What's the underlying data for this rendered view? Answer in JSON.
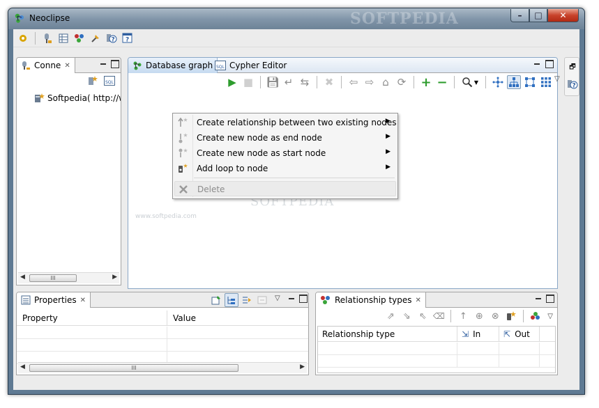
{
  "window": {
    "title": "Neoclipse",
    "watermark": "SOFTPEDIA",
    "controls": {
      "minimize": "–",
      "maximize": "□",
      "close": "✕"
    }
  },
  "main_toolbar": {
    "icons": [
      "preferences-icon",
      "connection-icon",
      "table-icon",
      "node-colors-icon",
      "pin-icon",
      "help-icon",
      "help-contents-icon"
    ]
  },
  "connections": {
    "tab_label": "Conne",
    "items": [
      {
        "label": "Softpedia( http://wv"
      }
    ],
    "scroll_thumb": "III"
  },
  "editor": {
    "tabs": [
      {
        "label": "Database graph"
      },
      {
        "label": "Cypher Editor"
      }
    ],
    "canvas_watermark": "SOFTPEDIA",
    "canvas_watermark_url": "www.softpedia.com"
  },
  "context_menu": {
    "items": [
      {
        "label": "Create relationship between two existing nodes",
        "submenu": true
      },
      {
        "label": "Create new node as end node",
        "submenu": true
      },
      {
        "label": "Create new node as start node",
        "submenu": true
      },
      {
        "label": "Add loop to node",
        "submenu": true
      },
      {
        "label": "Delete",
        "submenu": false,
        "disabled": true
      }
    ]
  },
  "properties": {
    "tab_label": "Properties",
    "columns": [
      "Property",
      "Value"
    ],
    "scroll_thumb": "III"
  },
  "relationship_types": {
    "tab_label": "Relationship types",
    "columns": [
      "Relationship type",
      "In",
      "Out"
    ]
  },
  "colors": {
    "window_frame": "#5f7a93",
    "client_bg": "#ececec",
    "active_tab": "#c5daf0",
    "add_green": "#2e9c2e",
    "delete_red": "#c0392b"
  }
}
